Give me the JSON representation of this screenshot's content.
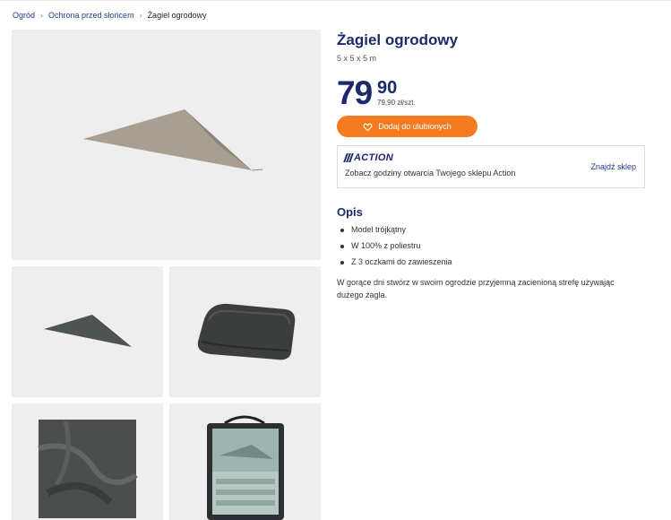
{
  "breadcrumb": {
    "items": [
      "Ogród",
      "Ochrona przed słońcem"
    ],
    "current": "Żagiel ogrodowy"
  },
  "product": {
    "title": "Żagiel ogrodowy",
    "size": "5 x 5 x 5 m",
    "price_whole": "79",
    "price_cents": "90",
    "price_unit": "79,90 zł/szt.",
    "favorite_label": "Dodaj do ulubionych"
  },
  "store": {
    "logo_text": "ACTION",
    "text": "Zobacz godziny otwarcia Twojego sklepu Action",
    "link": "Znajdź sklep"
  },
  "description": {
    "title": "Opis",
    "features": [
      "Model trójkątny",
      "W 100% z poliestru",
      "Z 3 oczkami do zawieszenia"
    ],
    "text": "W gorące dni stwórz w swoim ogrodzie przyjemną zacienioną strefę używając dużego żagla."
  },
  "colors": {
    "brand_blue": "#1c2a6b",
    "accent_orange": "#f47b20",
    "tile_bg": "#eeeeee"
  }
}
